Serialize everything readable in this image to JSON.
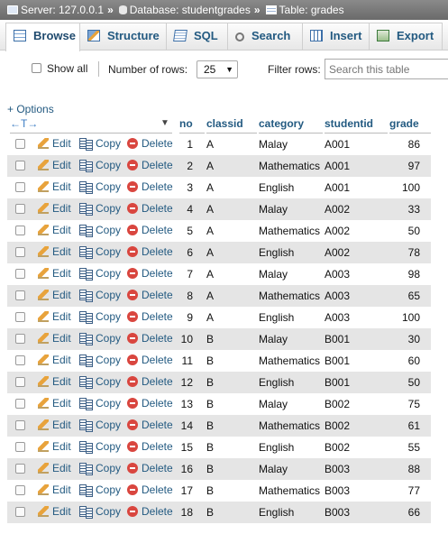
{
  "breadcrumb": {
    "server": "Server: 127.0.0.1",
    "database": "Database: studentgrades",
    "table": "Table: grades",
    "separator": "»"
  },
  "tabs": [
    {
      "label": "Browse",
      "icon": "browse-icon",
      "active": true
    },
    {
      "label": "Structure",
      "icon": "structure-icon",
      "active": false
    },
    {
      "label": "SQL",
      "icon": "sql-icon",
      "active": false
    },
    {
      "label": "Search",
      "icon": "search-icon",
      "active": false
    },
    {
      "label": "Insert",
      "icon": "insert-icon",
      "active": false
    },
    {
      "label": "Export",
      "icon": "export-icon",
      "active": false
    }
  ],
  "controls": {
    "show_all_label": "Show all",
    "rows_label": "Number of rows:",
    "rows_value": "25",
    "filter_label": "Filter rows:",
    "filter_placeholder": "Search this table"
  },
  "options_label": "+ Options",
  "table": {
    "columns": [
      "no",
      "classid",
      "category",
      "studentid",
      "grade"
    ],
    "actions": {
      "edit": "Edit",
      "copy": "Copy",
      "delete": "Delete"
    },
    "rows": [
      [
        "1",
        "A",
        "Malay",
        "A001",
        "86"
      ],
      [
        "2",
        "A",
        "Mathematics",
        "A001",
        "97"
      ],
      [
        "3",
        "A",
        "English",
        "A001",
        "100"
      ],
      [
        "4",
        "A",
        "Malay",
        "A002",
        "33"
      ],
      [
        "5",
        "A",
        "Mathematics",
        "A002",
        "50"
      ],
      [
        "6",
        "A",
        "English",
        "A002",
        "78"
      ],
      [
        "7",
        "A",
        "Malay",
        "A003",
        "98"
      ],
      [
        "8",
        "A",
        "Mathematics",
        "A003",
        "65"
      ],
      [
        "9",
        "A",
        "English",
        "A003",
        "100"
      ],
      [
        "10",
        "B",
        "Malay",
        "B001",
        "30"
      ],
      [
        "11",
        "B",
        "Mathematics",
        "B001",
        "60"
      ],
      [
        "12",
        "B",
        "English",
        "B001",
        "50"
      ],
      [
        "13",
        "B",
        "Malay",
        "B002",
        "75"
      ],
      [
        "14",
        "B",
        "Mathematics",
        "B002",
        "61"
      ],
      [
        "15",
        "B",
        "English",
        "B002",
        "55"
      ],
      [
        "16",
        "B",
        "Malay",
        "B003",
        "88"
      ],
      [
        "17",
        "B",
        "Mathematics",
        "B003",
        "77"
      ],
      [
        "18",
        "B",
        "English",
        "B003",
        "66"
      ]
    ]
  },
  "colors": {
    "link": "#235a81",
    "row_alt": "#e5e5e5",
    "breadcrumb_bg": "#7a7a7a"
  }
}
